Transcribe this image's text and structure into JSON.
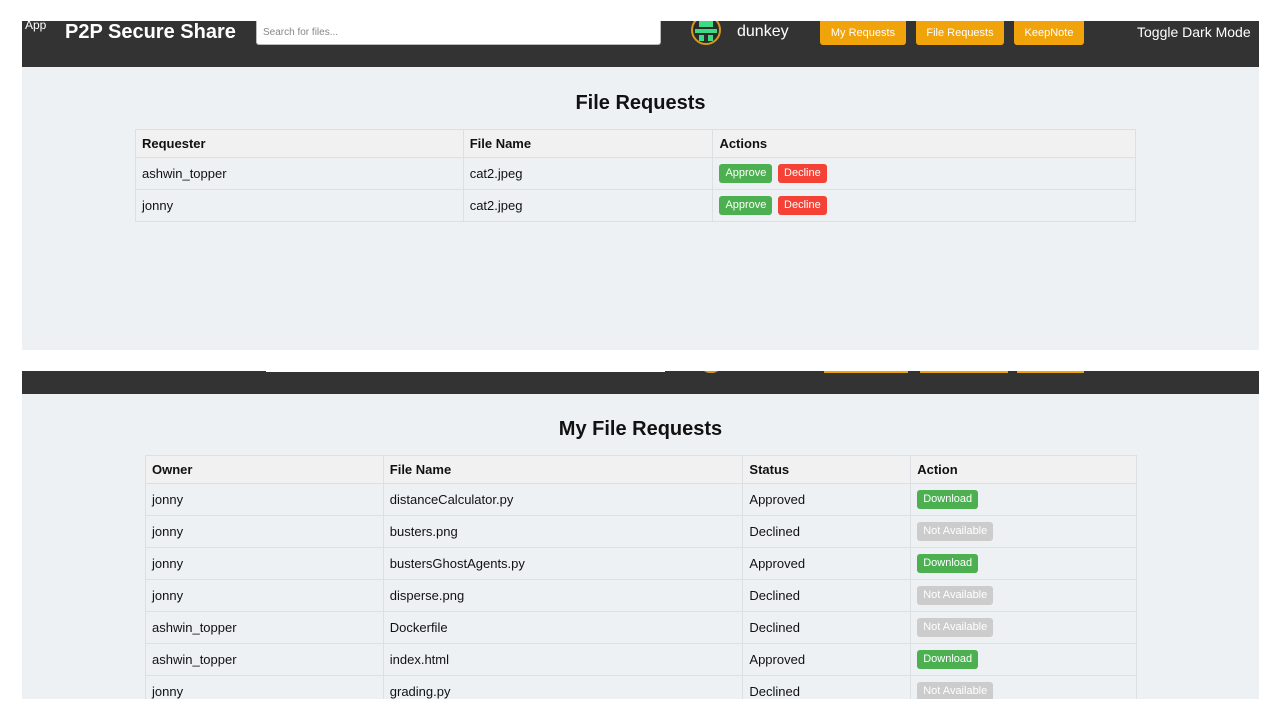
{
  "app": {
    "logo_text": "App",
    "title": "P2P Secure Share",
    "search_placeholder": "Search for files...",
    "username": "dunkey",
    "nav": {
      "my_requests": "My Requests",
      "file_requests": "File Requests",
      "keepnote": "KeepNote",
      "toggle_dark": "Toggle Dark Mode"
    },
    "colors": {
      "navbar": "#333333",
      "nav_button": "#f0a30a",
      "approve": "#4caf50",
      "decline": "#f44336",
      "disabled": "#cccccc"
    }
  },
  "file_requests": {
    "title": "File Requests",
    "headers": {
      "requester": "Requester",
      "file_name": "File Name",
      "actions": "Actions"
    },
    "rows": [
      {
        "requester": "ashwin_topper",
        "file_name": "cat2.jpeg",
        "approve": "Approve",
        "decline": "Decline"
      },
      {
        "requester": "jonny",
        "file_name": "cat2.jpeg",
        "approve": "Approve",
        "decline": "Decline"
      }
    ]
  },
  "my_file_requests": {
    "title": "My File Requests",
    "headers": {
      "owner": "Owner",
      "file_name": "File Name",
      "status": "Status",
      "action": "Action"
    },
    "rows": [
      {
        "owner": "jonny",
        "file_name": "distanceCalculator.py",
        "status": "Approved",
        "action": "Download"
      },
      {
        "owner": "jonny",
        "file_name": "busters.png",
        "status": "Declined",
        "action": "Not Available"
      },
      {
        "owner": "jonny",
        "file_name": "bustersGhostAgents.py",
        "status": "Approved",
        "action": "Download"
      },
      {
        "owner": "jonny",
        "file_name": "disperse.png",
        "status": "Declined",
        "action": "Not Available"
      },
      {
        "owner": "ashwin_topper",
        "file_name": "Dockerfile",
        "status": "Declined",
        "action": "Not Available"
      },
      {
        "owner": "ashwin_topper",
        "file_name": "index.html",
        "status": "Approved",
        "action": "Download"
      },
      {
        "owner": "jonny",
        "file_name": "grading.py",
        "status": "Declined",
        "action": "Not Available"
      }
    ]
  }
}
